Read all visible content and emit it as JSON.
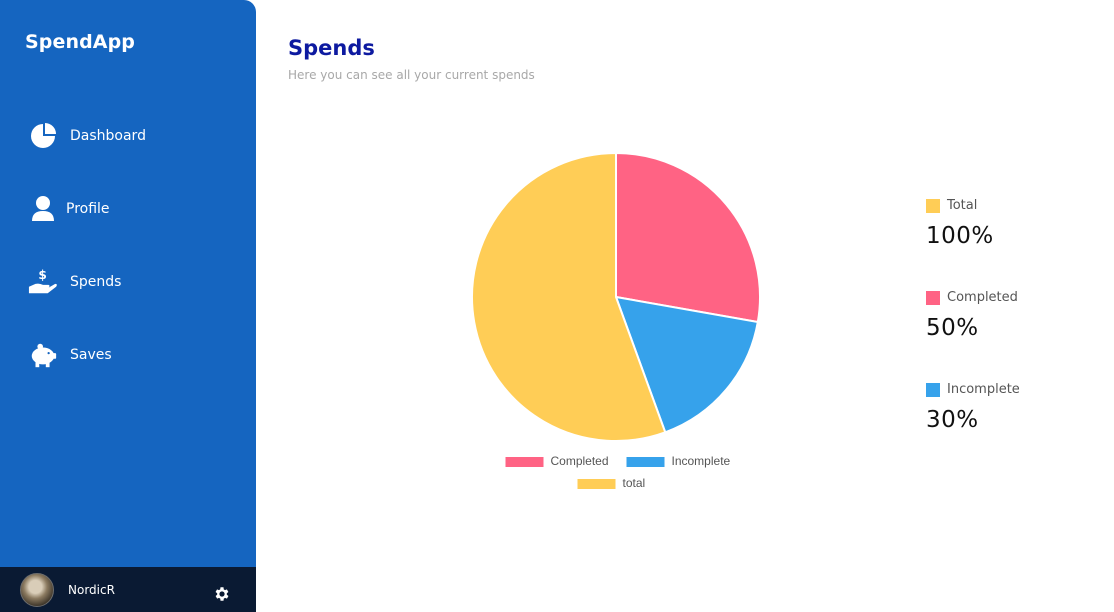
{
  "app": {
    "brand": "SpendApp"
  },
  "sidebar": {
    "items": [
      {
        "label": "Dashboard",
        "icon": "pie-chart-icon"
      },
      {
        "label": "Profile",
        "icon": "user-icon"
      },
      {
        "label": "Spends",
        "icon": "hand-money-icon"
      },
      {
        "label": "Saves",
        "icon": "piggy-bank-icon"
      }
    ],
    "user": {
      "name": "NordicR",
      "avatar_icon": "avatar",
      "settings_icon": "gear-icon"
    }
  },
  "main": {
    "title": "Spends",
    "subtitle": "Here you can see all your current spends"
  },
  "colors": {
    "sidebar": "#1565c0",
    "completed": "#ff6384",
    "incomplete": "#36a2eb",
    "total": "#ffcd56",
    "title": "#0d1aa0"
  },
  "chart_data": {
    "type": "pie",
    "slices": [
      {
        "label": "Completed",
        "value": 50,
        "color": "#ff6384"
      },
      {
        "label": "Incomplete",
        "value": 30,
        "color": "#36a2eb"
      },
      {
        "label": "total",
        "value": 100,
        "color": "#ffcd56"
      }
    ],
    "legend": [
      "Completed",
      "Incomplete",
      "total"
    ],
    "legend_position": "bottom"
  },
  "stats": [
    {
      "label": "Total",
      "value": "100%",
      "color": "#ffcd56"
    },
    {
      "label": "Completed",
      "value": "50%",
      "color": "#ff6384"
    },
    {
      "label": "Incomplete",
      "value": "30%",
      "color": "#36a2eb"
    }
  ]
}
